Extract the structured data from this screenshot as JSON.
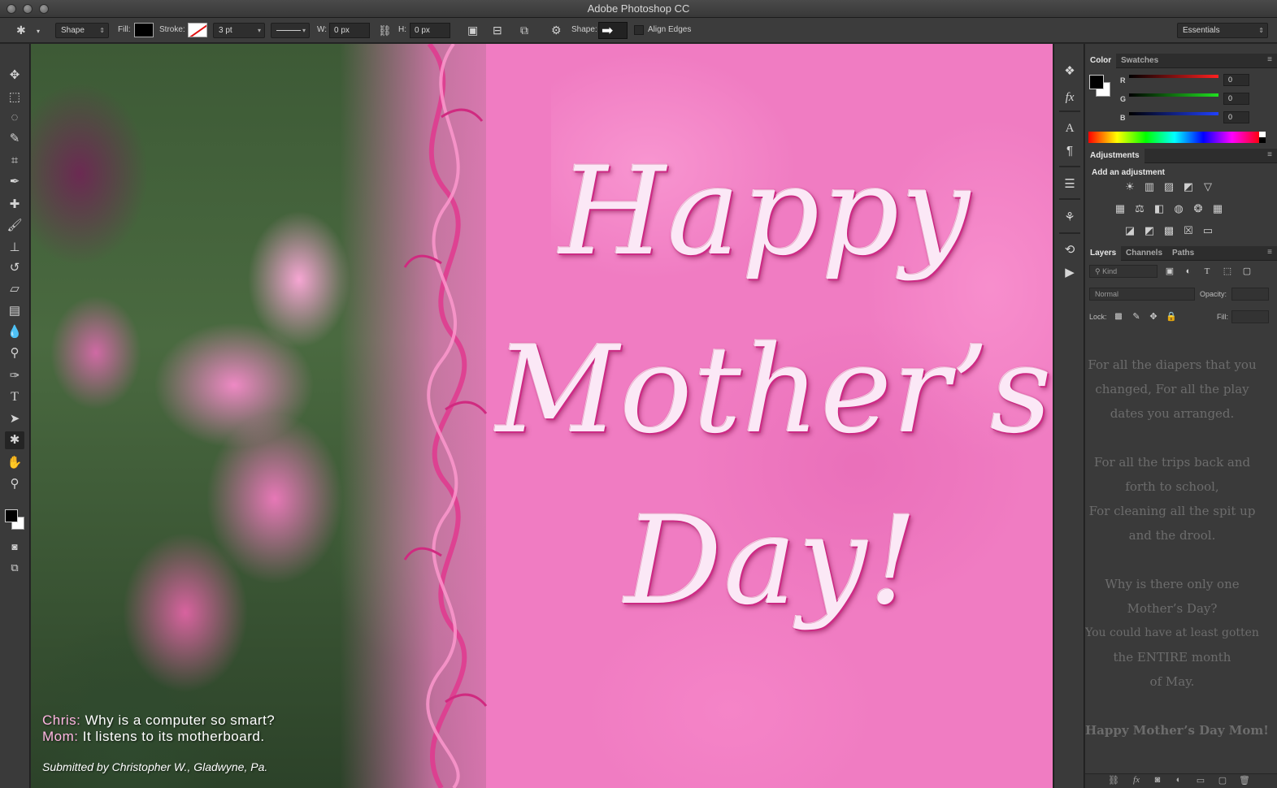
{
  "window": {
    "title": "Adobe Photoshop CC"
  },
  "options_bar": {
    "tool_mode": "Shape",
    "fill_label": "Fill:",
    "stroke_label": "Stroke:",
    "stroke_width": "3 pt",
    "w_label": "W:",
    "w_value": "0 px",
    "h_label": "H:",
    "h_value": "0 px",
    "shape_label": "Shape:",
    "align_edges_label": "Align Edges",
    "workspace": "Essentials"
  },
  "canvas": {
    "greeting_line1": "Happy",
    "greeting_line2": "Mother’s",
    "greeting_line3": "Day!",
    "joke_q_speaker": "Chris:",
    "joke_q_text": " Why is a computer so smart?",
    "joke_a_speaker": "Mom:",
    "joke_a_text": " It listens to its motherboard.",
    "credit": "Submitted by Christopher W., Gladwyne, Pa."
  },
  "color_panel": {
    "tabs": [
      "Color",
      "Swatches"
    ],
    "channels": [
      {
        "name": "R",
        "value": "0"
      },
      {
        "name": "G",
        "value": "0"
      },
      {
        "name": "B",
        "value": "0"
      }
    ]
  },
  "adjustments_panel": {
    "tab": "Adjustments",
    "title": "Add an adjustment"
  },
  "layers_panel": {
    "tabs": [
      "Layers",
      "Channels",
      "Paths"
    ],
    "filter_kind": "Kind",
    "blend_mode": "Normal",
    "opacity_label": "Opacity:",
    "lock_label": "Lock:",
    "fill_label": "Fill:",
    "message_lines": [
      "For all the diapers that you",
      "changed, For all the play",
      "dates you arranged.",
      "",
      "For all the trips back and",
      "forth to school,",
      "For cleaning all the spit up",
      "and the drool.",
      "",
      "Why is there only one",
      "Mother’s Day?",
      "You could have at least gotten",
      "the ENTIRE month",
      "of May.",
      "",
      "Happy Mother’s Day Mom!"
    ]
  },
  "colors": {
    "canvas_pink": "#f07cc2",
    "ui_dark": "#3a3a3a",
    "joke_speaker": "#ffb6e2"
  }
}
